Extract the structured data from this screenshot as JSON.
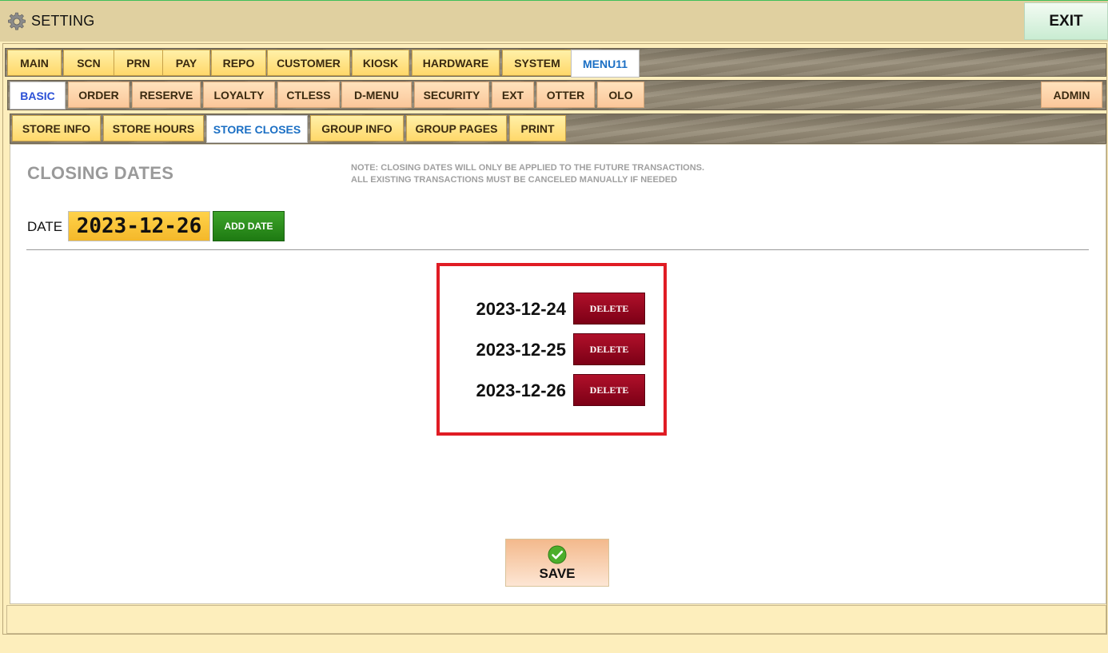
{
  "window": {
    "title": "SETTING",
    "exit_label": "EXIT"
  },
  "tabs_main": [
    {
      "label": "MAIN"
    },
    {
      "label": "SCN"
    },
    {
      "label": "PRN"
    },
    {
      "label": "PAY"
    },
    {
      "label": "REPO"
    },
    {
      "label": "CUSTOMER"
    },
    {
      "label": "KIOSK"
    },
    {
      "label": "HARDWARE"
    },
    {
      "label": "SYSTEM"
    },
    {
      "label": "MENU11"
    }
  ],
  "tabs_sub": [
    {
      "label": "BASIC"
    },
    {
      "label": "ORDER"
    },
    {
      "label": "RESERVE"
    },
    {
      "label": "LOYALTY"
    },
    {
      "label": "CTLESS"
    },
    {
      "label": "D-MENU"
    },
    {
      "label": "SECURITY"
    },
    {
      "label": "EXT"
    },
    {
      "label": "OTTER"
    },
    {
      "label": "OLO"
    },
    {
      "label": "ADMIN"
    }
  ],
  "tabs_basic": [
    {
      "label": "STORE INFO"
    },
    {
      "label": "STORE HOURS"
    },
    {
      "label": "STORE CLOSES"
    },
    {
      "label": "GROUP INFO"
    },
    {
      "label": "GROUP PAGES"
    },
    {
      "label": "PRINT"
    }
  ],
  "active_tabs": {
    "main": "MENU11",
    "sub": "BASIC",
    "basic": "STORE CLOSES"
  },
  "content": {
    "heading": "CLOSING DATES",
    "note_line1": "NOTE: CLOSING DATES WILL ONLY BE APPLIED TO THE FUTURE TRANSACTIONS.",
    "note_line2": "ALL EXISTING TRANSACTIONS MUST BE CANCELED MANUALLY IF NEEDED",
    "date_label": "DATE",
    "date_value": "2023-12-26",
    "add_label": "ADD DATE",
    "closing_dates": [
      {
        "date": "2023-12-24",
        "delete_label": "DELETE"
      },
      {
        "date": "2023-12-25",
        "delete_label": "DELETE"
      },
      {
        "date": "2023-12-26",
        "delete_label": "DELETE"
      }
    ],
    "save_label": "SAVE"
  },
  "colors": {
    "accent_red": "#e01c24",
    "delete_red": "#8c0a20",
    "add_green": "#2a8f1c",
    "tab_yellow": "#ffd86a",
    "tab_peach": "#fbc79a",
    "active_tab_text": "#1b6fc4"
  },
  "icons": {
    "title": "gear-icon",
    "save": "check-circle-icon"
  }
}
